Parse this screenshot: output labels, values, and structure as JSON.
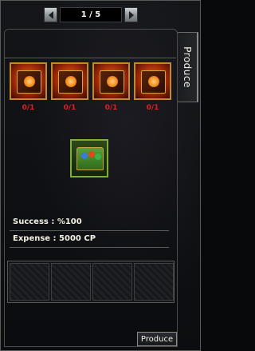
{
  "pager": {
    "text": "1 / 5"
  },
  "side_tab": {
    "label": "Produce"
  },
  "ingredients": [
    {
      "count": "0/1"
    },
    {
      "count": "0/1"
    },
    {
      "count": "0/1"
    },
    {
      "count": "0/1"
    }
  ],
  "stats": {
    "success": "Success : %100",
    "expense": "Expense : 5000 CP"
  },
  "produce_button": {
    "label": "Produce"
  },
  "colors": {
    "count_red": "#e02020",
    "ingredient_border": "#c28a2a",
    "product_border": "#7cae38"
  },
  "icons": {
    "ingredient": "paw-book-icon",
    "product": "treasure-chest-icon",
    "prev": "triangle-left-icon",
    "next": "triangle-right-icon"
  }
}
